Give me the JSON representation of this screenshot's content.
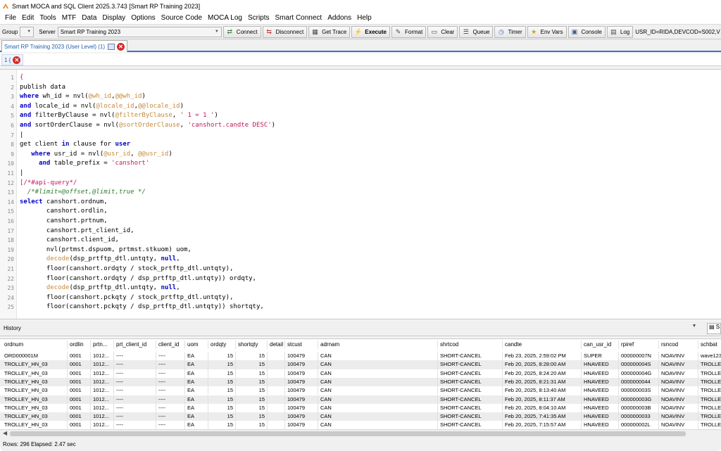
{
  "window": {
    "title": "Smart MOCA and SQL Client 2025.3.743 [Smart RP Training 2023]"
  },
  "menu": [
    "File",
    "Edit",
    "Tools",
    "MTF",
    "Data",
    "Display",
    "Options",
    "Source Code",
    "MOCA Log",
    "Scripts",
    "Smart Connect",
    "Addons",
    "Help"
  ],
  "toolbar": {
    "group_label": "Group",
    "server_label": "Server",
    "server_value": "Smart RP Training 2023",
    "buttons": [
      {
        "label": "Connect",
        "icon": "connect-icon"
      },
      {
        "label": "Disconnect",
        "icon": "disconnect-icon"
      },
      {
        "label": "Get Trace",
        "icon": "trace-icon"
      },
      {
        "label": "Execute",
        "icon": "lightning-icon"
      },
      {
        "label": "Format",
        "icon": "format-icon"
      },
      {
        "label": "Clear",
        "icon": "eraser-icon"
      },
      {
        "label": "Queue",
        "icon": "queue-icon"
      },
      {
        "label": "Timer",
        "icon": "timer-icon"
      },
      {
        "label": "Env Vars",
        "icon": "star-icon"
      },
      {
        "label": "Console",
        "icon": "console-icon"
      },
      {
        "label": "Log",
        "icon": "log-icon"
      }
    ],
    "status": "USR_ID=RIDA,DEVCOD=S002,V"
  },
  "doc_tab": {
    "label": "Smart RP Training 2023 (User Level) (1)"
  },
  "editor_tab": {
    "label": "1 {"
  },
  "editor_lines": [
    {
      "n": "1",
      "tokens": [
        {
          "c": "str",
          "t": "{"
        }
      ]
    },
    {
      "n": "2",
      "tokens": [
        {
          "c": "plain",
          "t": "publish data"
        }
      ]
    },
    {
      "n": "3",
      "tokens": [
        {
          "c": "kw",
          "t": "where"
        },
        {
          "c": "plain",
          "t": " wh_id = nvl("
        },
        {
          "c": "var",
          "t": "@wh_id"
        },
        {
          "c": "plain",
          "t": ","
        },
        {
          "c": "var",
          "t": "@@wh_id"
        },
        {
          "c": "plain",
          "t": ")"
        }
      ]
    },
    {
      "n": "4",
      "tokens": [
        {
          "c": "kw",
          "t": "and"
        },
        {
          "c": "plain",
          "t": " locale_id = nvl("
        },
        {
          "c": "var",
          "t": "@locale_id"
        },
        {
          "c": "plain",
          "t": ","
        },
        {
          "c": "var",
          "t": "@@locale_id"
        },
        {
          "c": "plain",
          "t": ")"
        }
      ]
    },
    {
      "n": "5",
      "tokens": [
        {
          "c": "kw",
          "t": "and"
        },
        {
          "c": "plain",
          "t": " filterByClause = nvl("
        },
        {
          "c": "var",
          "t": "@filterByClause"
        },
        {
          "c": "plain",
          "t": ", "
        },
        {
          "c": "str",
          "t": "' 1 = 1 '"
        },
        {
          "c": "plain",
          "t": ")"
        }
      ]
    },
    {
      "n": "6",
      "tokens": [
        {
          "c": "kw",
          "t": "and"
        },
        {
          "c": "plain",
          "t": " sortOrderClause = nvl("
        },
        {
          "c": "var",
          "t": "@sortOrderClause"
        },
        {
          "c": "plain",
          "t": ", "
        },
        {
          "c": "str",
          "t": "'canshort.candte DESC'"
        },
        {
          "c": "plain",
          "t": ")"
        }
      ]
    },
    {
      "n": "7",
      "tokens": [
        {
          "c": "plain",
          "t": "|"
        }
      ]
    },
    {
      "n": "8",
      "tokens": [
        {
          "c": "plain",
          "t": "get client "
        },
        {
          "c": "kw",
          "t": "in"
        },
        {
          "c": "plain",
          "t": " clause for "
        },
        {
          "c": "kw",
          "t": "user"
        }
      ]
    },
    {
      "n": "9",
      "tokens": [
        {
          "c": "plain",
          "t": "   "
        },
        {
          "c": "kw",
          "t": "where"
        },
        {
          "c": "plain",
          "t": " usr_id = nvl("
        },
        {
          "c": "var",
          "t": "@usr_id"
        },
        {
          "c": "plain",
          "t": ", "
        },
        {
          "c": "var",
          "t": "@@usr_id"
        },
        {
          "c": "plain",
          "t": ")"
        }
      ]
    },
    {
      "n": "10",
      "tokens": [
        {
          "c": "plain",
          "t": "     "
        },
        {
          "c": "kw",
          "t": "and"
        },
        {
          "c": "plain",
          "t": " table_prefix = "
        },
        {
          "c": "str",
          "t": "'canshort'"
        }
      ]
    },
    {
      "n": "11",
      "tokens": [
        {
          "c": "plain",
          "t": "|"
        }
      ]
    },
    {
      "n": "12",
      "tokens": [
        {
          "c": "str",
          "t": "[/*#api-query*/"
        }
      ]
    },
    {
      "n": "13",
      "tokens": [
        {
          "c": "cmt",
          "t": "  /*#limit=@offset,@limit,true */"
        }
      ]
    },
    {
      "n": "14",
      "tokens": [
        {
          "c": "kw",
          "t": "select"
        },
        {
          "c": "plain",
          "t": " canshort.ordnum,"
        }
      ]
    },
    {
      "n": "15",
      "tokens": [
        {
          "c": "plain",
          "t": "       canshort.ordlin,"
        }
      ]
    },
    {
      "n": "16",
      "tokens": [
        {
          "c": "plain",
          "t": "       canshort.prtnum,"
        }
      ]
    },
    {
      "n": "17",
      "tokens": [
        {
          "c": "plain",
          "t": "       canshort.prt_client_id,"
        }
      ]
    },
    {
      "n": "18",
      "tokens": [
        {
          "c": "plain",
          "t": "       canshort.client_id,"
        }
      ]
    },
    {
      "n": "19",
      "tokens": [
        {
          "c": "plain",
          "t": "       nvl(prtmst.dspuom, prtmst.stkuom) uom,"
        }
      ]
    },
    {
      "n": "20",
      "tokens": [
        {
          "c": "fn",
          "t": "       decode"
        },
        {
          "c": "plain",
          "t": "(dsp_prtftp_dtl.untqty, "
        },
        {
          "c": "kw",
          "t": "null"
        },
        {
          "c": "plain",
          "t": ","
        }
      ]
    },
    {
      "n": "21",
      "tokens": [
        {
          "c": "plain",
          "t": "       floor(canshort.ordqty / stock_prtftp_dtl.untqty),"
        }
      ]
    },
    {
      "n": "22",
      "tokens": [
        {
          "c": "plain",
          "t": "       floor(canshort.ordqty / dsp_prtftp_dtl.untqty)) ordqty,"
        }
      ]
    },
    {
      "n": "23",
      "tokens": [
        {
          "c": "fn",
          "t": "       decode"
        },
        {
          "c": "plain",
          "t": "(dsp_prtftp_dtl.untqty, "
        },
        {
          "c": "kw",
          "t": "null"
        },
        {
          "c": "plain",
          "t": ","
        }
      ]
    },
    {
      "n": "24",
      "tokens": [
        {
          "c": "plain",
          "t": "       floor(canshort.pckqty / stock_prtftp_dtl.untqty),"
        }
      ]
    },
    {
      "n": "25",
      "tokens": [
        {
          "c": "plain",
          "t": "       floor(canshort.pckqty / dsp_prtftp_dtl.untqty)) shortqty,"
        }
      ]
    }
  ],
  "history": {
    "label": "History",
    "side_label": "S"
  },
  "grid": {
    "columns": [
      "ordnum",
      "ordlin",
      "prtn...",
      "prt_client_id",
      "client_id",
      "uom",
      "ordqty",
      "shortqty",
      "detail",
      "stcust",
      "adrnam",
      "shrtcod",
      "candte",
      "can_usr_id",
      "rpiref",
      "rsncod",
      "schbat"
    ],
    "rows": [
      [
        "ORD000001M",
        "0001",
        "1012...",
        "----",
        "----",
        "EA",
        "15",
        "15",
        "",
        "100479",
        "CAN",
        "SHORT-CANCEL",
        "Feb 23, 2025, 2:59:02 PM",
        "SUPER",
        "000000007N",
        "NOAVINV",
        "wave123"
      ],
      [
        "TROLLEY_HN_03",
        "0001",
        "1012...",
        "----",
        "----",
        "EA",
        "15",
        "15",
        "",
        "100479",
        "CAN",
        "SHORT-CANCEL",
        "Feb 20, 2025, 8:28:00 AM",
        "HNAVEED",
        "000000004S",
        "NOAVINV",
        "TROLLEY"
      ],
      [
        "TROLLEY_HN_03",
        "0001",
        "1012...",
        "----",
        "----",
        "EA",
        "15",
        "15",
        "",
        "100479",
        "CAN",
        "SHORT-CANCEL",
        "Feb 20, 2025, 8:24:20 AM",
        "HNAVEED",
        "000000004G",
        "NOAVINV",
        "TROLLEY"
      ],
      [
        "TROLLEY_HN_03",
        "0001",
        "1012...",
        "----",
        "----",
        "EA",
        "15",
        "15",
        "",
        "100479",
        "CAN",
        "SHORT-CANCEL",
        "Feb 20, 2025, 8:21:31 AM",
        "HNAVEED",
        "0000000044",
        "NOAVINV",
        "TROLLEY"
      ],
      [
        "TROLLEY_HN_03",
        "0001",
        "1012...",
        "----",
        "----",
        "EA",
        "15",
        "15",
        "",
        "100479",
        "CAN",
        "SHORT-CANCEL",
        "Feb 20, 2025, 8:13:40 AM",
        "HNAVEED",
        "000000003S",
        "NOAVINV",
        "TROLLEY"
      ],
      [
        "TROLLEY_HN_03",
        "0001",
        "1012...",
        "----",
        "----",
        "EA",
        "15",
        "15",
        "",
        "100479",
        "CAN",
        "SHORT-CANCEL",
        "Feb 20, 2025, 8:11:37 AM",
        "HNAVEED",
        "000000003G",
        "NOAVINV",
        "TROLLEY"
      ],
      [
        "TROLLEY_HN_03",
        "0001",
        "1012...",
        "----",
        "----",
        "EA",
        "15",
        "15",
        "",
        "100479",
        "CAN",
        "SHORT-CANCEL",
        "Feb 20, 2025, 8:04:10 AM",
        "HNAVEED",
        "000000003B",
        "NOAVINV",
        "TROLLEY"
      ],
      [
        "TROLLEY_HN_03",
        "0001",
        "1012...",
        "----",
        "----",
        "EA",
        "15",
        "15",
        "",
        "100479",
        "CAN",
        "SHORT-CANCEL",
        "Feb 20, 2025, 7:41:35 AM",
        "HNAVEED",
        "0000000033",
        "NOAVINV",
        "TROLLEY"
      ],
      [
        "TROLLEY_HN_03",
        "0001",
        "1012...",
        "----",
        "----",
        "EA",
        "15",
        "15",
        "",
        "100479",
        "CAN",
        "SHORT-CANCEL",
        "Feb 20, 2025, 7:15:57 AM",
        "HNAVEED",
        "000000002L",
        "NOAVINV",
        "TROLLEY"
      ]
    ]
  },
  "status": {
    "text": "Rows: 296 Elapsed: 2.47 sec"
  },
  "colors": {
    "accent": "#3b73c8",
    "close": "#d62b2b",
    "keyword": "#0000c8",
    "variable": "#c68a3c",
    "string": "#c2185b",
    "comment": "#2e7d32"
  }
}
